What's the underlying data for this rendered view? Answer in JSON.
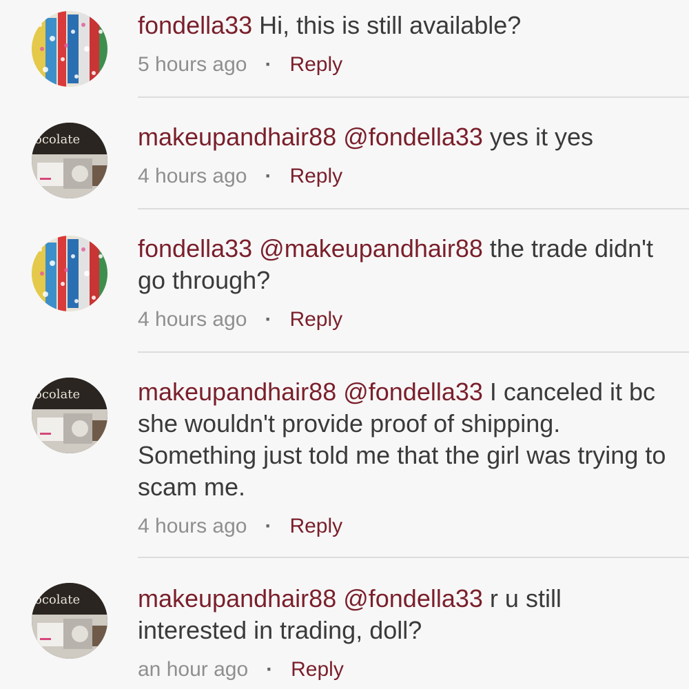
{
  "comments": [
    {
      "user": "fondella33",
      "mention": "",
      "text": " Hi, this is still available?",
      "time": "5 hours ago",
      "reply_label": "Reply",
      "avatar": "paint-splatter"
    },
    {
      "user": "makeupandhair88",
      "mention": " @fondella33",
      "text": " yes it yes",
      "time": "4 hours ago",
      "reply_label": "Reply",
      "avatar": "chocolate-box",
      "avatar_text": "ocolate"
    },
    {
      "user": "fondella33",
      "mention": " @makeupandhair88",
      "text": " the trade didn't go through?",
      "time": "4 hours ago",
      "reply_label": "Reply",
      "avatar": "paint-splatter"
    },
    {
      "user": "makeupandhair88",
      "mention": " @fondella33",
      "text": " I canceled it bc she wouldn't provide proof of shipping. Something just told me that the girl was trying to scam me.",
      "time": "4 hours ago",
      "reply_label": "Reply",
      "avatar": "chocolate-box",
      "avatar_text": "ocolate"
    },
    {
      "user": "makeupandhair88",
      "mention": " @fondella33",
      "text": " r u still interested in trading, doll?",
      "time": "an hour ago",
      "reply_label": "Reply",
      "avatar": "chocolate-box",
      "avatar_text": "ocolate"
    }
  ],
  "separator": "·",
  "colors": {
    "username": "#7a1f2b",
    "body_text": "#3a3a3a",
    "meta_text": "#8f8f8f",
    "background": "#f7f7f7",
    "divider": "#dcdcdc"
  }
}
